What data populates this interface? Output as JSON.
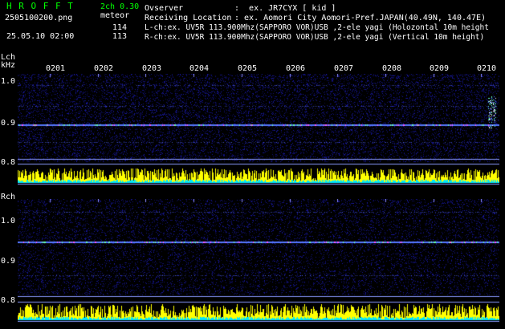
{
  "header": {
    "app_title": "H R O F F T",
    "channel_info": "2ch 0.30",
    "filename": "2505100200.png",
    "meteor_label": "meteor",
    "datetime": "25.05.10 02:00",
    "lch_count": "114",
    "rch_count": "113",
    "observer_label": "Ovserver",
    "observer_value": ":  ex. JR7CYX [ kid ]",
    "location_label": "Receiving Location",
    "location_value": ": ex. Aomori City Aomori-Pref.JAPAN(40.49N, 140.47E)",
    "lch_line": "L-ch:ex. UV5R 113.900Mhz(SAPPORO VOR)USB ,2-ele yagi (Holozontal 10m height",
    "rch_line": "R-ch:ex. UV5R 113.900Mhz(SAPPORO VOR)USB ,2-ele yagi (Vertical 10m height)"
  },
  "colors": {
    "title": "#00ff00",
    "text": "#ffffff",
    "background": "#000000",
    "noise": "#1a1a8a",
    "signal_line": "#4466ff",
    "count_bar": "#ffff00",
    "count_base": "#00ffff"
  },
  "lch": {
    "label": "Lch",
    "unit": "kHz",
    "y_labels": [
      "1.0",
      "0.9",
      "0.8"
    ]
  },
  "rch": {
    "label": "Rch",
    "y_labels": [
      "1.0",
      "0.9",
      "0.8"
    ]
  },
  "time_labels": [
    "0201",
    "0202",
    "0203",
    "0204",
    "0205",
    "0206",
    "0207",
    "0208",
    "0209",
    "0210"
  ]
}
